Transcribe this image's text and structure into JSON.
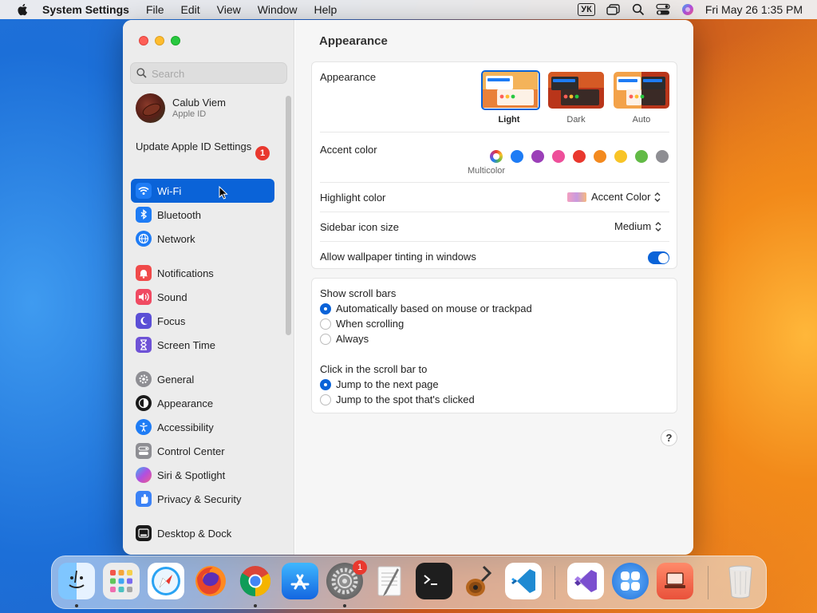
{
  "menubar": {
    "app_name": "System Settings",
    "items": [
      "File",
      "Edit",
      "View",
      "Window",
      "Help"
    ],
    "input_source": "УК",
    "datetime": "Fri May 26  1:35 PM"
  },
  "sidebar": {
    "search_placeholder": "Search",
    "user_name": "Calub Viem",
    "user_sub": "Apple ID",
    "update_text": "Update Apple ID Settings",
    "update_badge": "1",
    "items": [
      {
        "label": "Wi-Fi",
        "icon": "wifi-icon",
        "color": "#1e7cf5"
      },
      {
        "label": "Bluetooth",
        "icon": "bluetooth-icon",
        "color": "#1e7cf5"
      },
      {
        "label": "Network",
        "icon": "network-icon",
        "color": "#1e7cf5"
      },
      {
        "label": "Notifications",
        "icon": "notifications-icon",
        "color": "#f04a4a"
      },
      {
        "label": "Sound",
        "icon": "sound-icon",
        "color": "#f04a62"
      },
      {
        "label": "Focus",
        "icon": "focus-icon",
        "color": "#5b4fd6"
      },
      {
        "label": "Screen Time",
        "icon": "screen-time-icon",
        "color": "#6e52d6"
      },
      {
        "label": "General",
        "icon": "general-icon",
        "color": "#8e8e93"
      },
      {
        "label": "Appearance",
        "icon": "appearance-icon",
        "color": "#1a1a1a"
      },
      {
        "label": "Accessibility",
        "icon": "accessibility-icon",
        "color": "#1e7cf5"
      },
      {
        "label": "Control Center",
        "icon": "control-center-icon",
        "color": "#8e8e93"
      },
      {
        "label": "Siri & Spotlight",
        "icon": "siri-icon",
        "color": "#333"
      },
      {
        "label": "Privacy & Security",
        "icon": "privacy-icon",
        "color": "#3b82f6"
      },
      {
        "label": "Desktop & Dock",
        "icon": "desktop-dock-icon",
        "color": "#1a1a1a"
      }
    ]
  },
  "main": {
    "title": "Appearance",
    "appearance_label": "Appearance",
    "modes": [
      {
        "label": "Light",
        "selected": true
      },
      {
        "label": "Dark",
        "selected": false
      },
      {
        "label": "Auto",
        "selected": false
      }
    ],
    "accent_label": "Accent color",
    "accent_colors": [
      "multicolor",
      "#1e7cf5",
      "#9b3fb8",
      "#ee4f9a",
      "#e9382e",
      "#f38a1f",
      "#f8c427",
      "#62ba46",
      "#8e8e93"
    ],
    "accent_selected_name": "Multicolor",
    "highlight_label": "Highlight color",
    "highlight_value": "Accent Color",
    "icon_size_label": "Sidebar icon size",
    "icon_size_value": "Medium",
    "tinting_label": "Allow wallpaper tinting in windows",
    "tinting_on": true,
    "scrollbars_label": "Show scroll bars",
    "scrollbar_options": [
      "Automatically based on mouse or trackpad",
      "When scrolling",
      "Always"
    ],
    "scrollbar_selected": 0,
    "click_label": "Click in the scroll bar to",
    "click_options": [
      "Jump to the next page",
      "Jump to the spot that's clicked"
    ],
    "click_selected": 0,
    "help": "?"
  },
  "dock": {
    "apps": [
      "Finder",
      "Launchpad",
      "Safari",
      "Firefox",
      "Chrome",
      "App Store",
      "System Settings",
      "TextEdit",
      "Terminal",
      "GarageBand",
      "Visual Studio Code",
      "Visual Studio",
      "Microsoft Remote Desktop",
      "Parallels",
      "Trash"
    ],
    "settings_badge": "1"
  }
}
